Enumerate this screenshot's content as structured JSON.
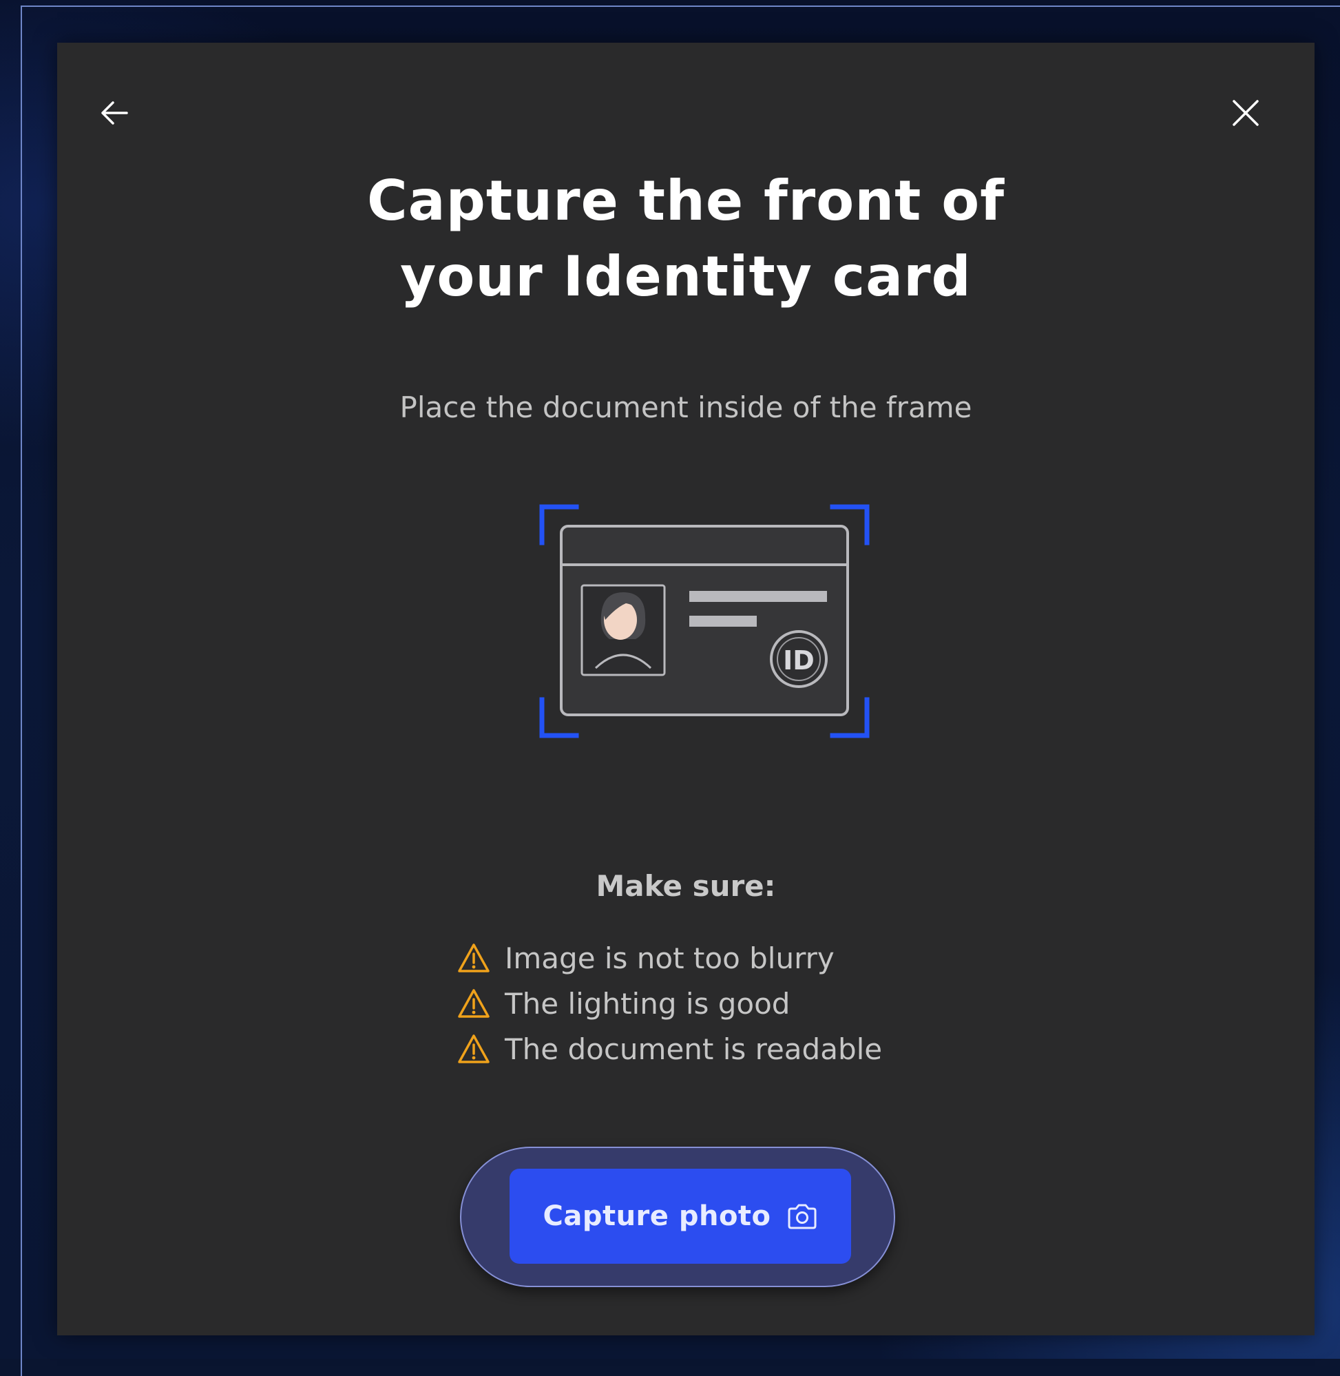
{
  "modal": {
    "title_line1": "Capture the front of",
    "title_line2": "your Identity card",
    "subtitle": "Place the document inside of the frame",
    "illustration": {
      "badge_text": "ID",
      "icon": "id-card-illustration",
      "frame_color": "#2352f5"
    },
    "checklist": {
      "heading": "Make sure:",
      "items": [
        {
          "icon": "warning-triangle-icon",
          "label": "Image is not too blurry"
        },
        {
          "icon": "warning-triangle-icon",
          "label": "The lighting is good"
        },
        {
          "icon": "warning-triangle-icon",
          "label": "The document is readable"
        }
      ],
      "warning_color": "#f0a21b"
    },
    "actions": {
      "capture_label": "Capture photo",
      "capture_icon": "camera-icon",
      "back_icon": "arrow-left-icon",
      "close_icon": "close-icon"
    }
  },
  "colors": {
    "modal_bg": "#2a2a2b",
    "accent": "#2c4df0",
    "page_bg": "#0a1530"
  }
}
